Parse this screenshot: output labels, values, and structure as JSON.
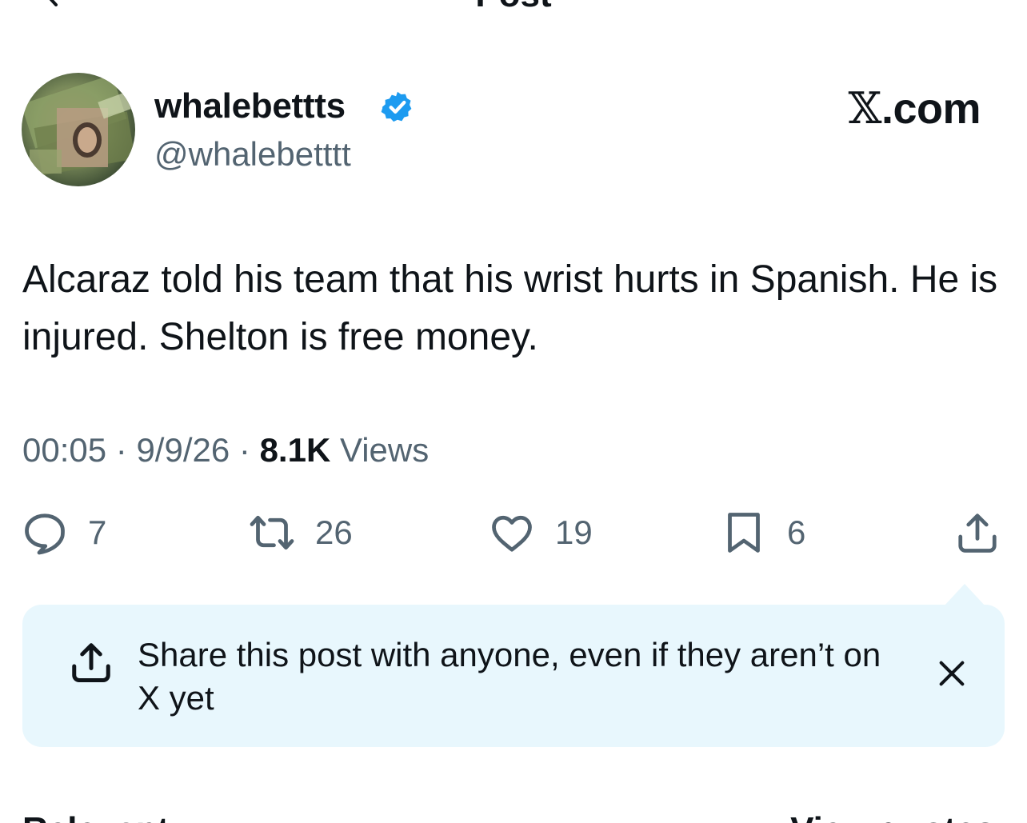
{
  "header": {
    "title": "Post",
    "back_icon": "back-arrow-icon"
  },
  "author": {
    "display_name": "whalebettts",
    "handle": "@whalebetttt",
    "verified_icon": "verified-badge-icon",
    "verified_color": "#1d9bf0"
  },
  "brand": {
    "logo": "𝕏",
    "suffix": ".com"
  },
  "post": {
    "text": "Alcaraz told his team that his wrist hurts in Spanish. He is injured. Shelton is free money.",
    "time": "00:05",
    "date": "9/9/26",
    "views_count": "8.1K",
    "views_label": "Views",
    "separator": "·"
  },
  "actions": {
    "replies": {
      "icon": "reply-icon",
      "count": "7"
    },
    "reposts": {
      "icon": "repost-icon",
      "count": "26"
    },
    "likes": {
      "icon": "heart-icon",
      "count": "19"
    },
    "bookmarks": {
      "icon": "bookmark-icon",
      "count": "6"
    },
    "share": {
      "icon": "share-icon"
    }
  },
  "share_banner": {
    "text": "Share this post with anyone, even if they aren’t on X yet",
    "background": "#e8f7fd"
  },
  "bottom": {
    "left_label": "Relevant",
    "right_label": "View quotes"
  },
  "colors": {
    "text": "#0f1419",
    "secondary": "#536471",
    "accent": "#1d9bf0"
  }
}
